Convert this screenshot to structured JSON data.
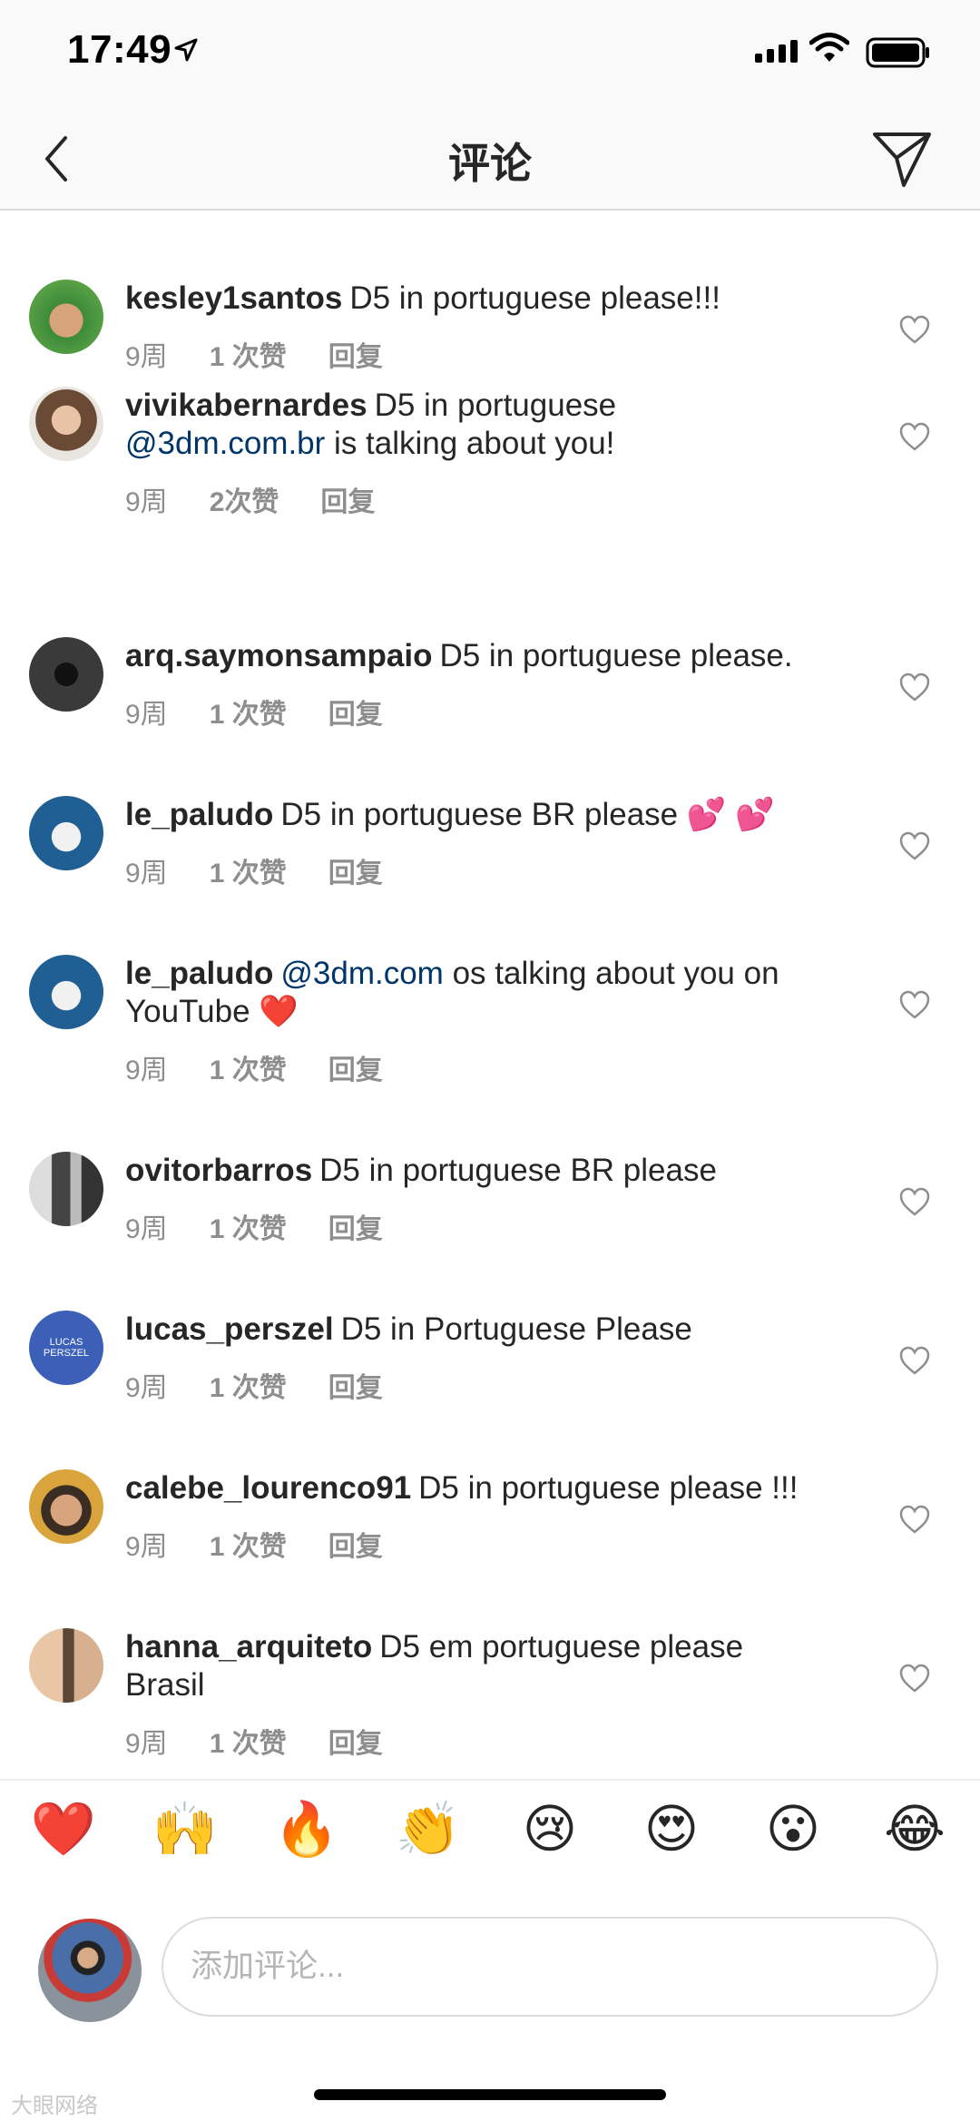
{
  "status_bar": {
    "time": "17:49"
  },
  "nav": {
    "title": "评论"
  },
  "comments": [
    {
      "username": "kesley1santos",
      "text": "D5 in portuguese please!!!",
      "age": "9周",
      "likes": "1 次赞",
      "reply": "回复"
    },
    {
      "username": "vivikabernardes",
      "text_pre": "D5 in portuguese",
      "mention": "@3dm.com.br",
      "text_post": " is talking about you!",
      "age": "9周",
      "likes": "2次赞",
      "reply": "回复"
    },
    {
      "username": "arq.saymonsampaio",
      "text": "D5 in portuguese please.",
      "age": "9周",
      "likes": "1 次赞",
      "reply": "回复"
    },
    {
      "username": "le_paludo",
      "text": "D5 in portuguese BR please 💕 💕",
      "age": "9周",
      "likes": "1 次赞",
      "reply": "回复"
    },
    {
      "username": "le_paludo",
      "mention": "@3dm.com",
      "text_post": " os talking about you on YouTube ❤️",
      "age": "9周",
      "likes": "1 次赞",
      "reply": "回复"
    },
    {
      "username": "ovitorbarros",
      "text": "D5 in portuguese BR please",
      "age": "9周",
      "likes": "1 次赞",
      "reply": "回复"
    },
    {
      "username": "lucas_perszel",
      "text": "D5 in Portuguese Please",
      "avatar_text": "LUCAS PERSZEL",
      "age": "9周",
      "likes": "1 次赞",
      "reply": "回复"
    },
    {
      "username": "calebe_lourenco91",
      "text": "D5 in portuguese please !!!",
      "age": "9周",
      "likes": "1 次赞",
      "reply": "回复"
    },
    {
      "username": "hanna_arquiteto",
      "text": "D5 em portuguese please Brasil",
      "age": "9周",
      "likes": "1 次赞",
      "reply": "回复"
    }
  ],
  "emoji_bar": [
    "❤️",
    "🙌",
    "🔥",
    "👏",
    "😢",
    "😍",
    "😮",
    "😂"
  ],
  "composer": {
    "placeholder": "添加评论..."
  },
  "watermark": "大眼网络",
  "colors": {
    "mention": "#003569",
    "meta": "#8e8e8e",
    "text": "#262626",
    "separator": "#dbdbdb"
  }
}
